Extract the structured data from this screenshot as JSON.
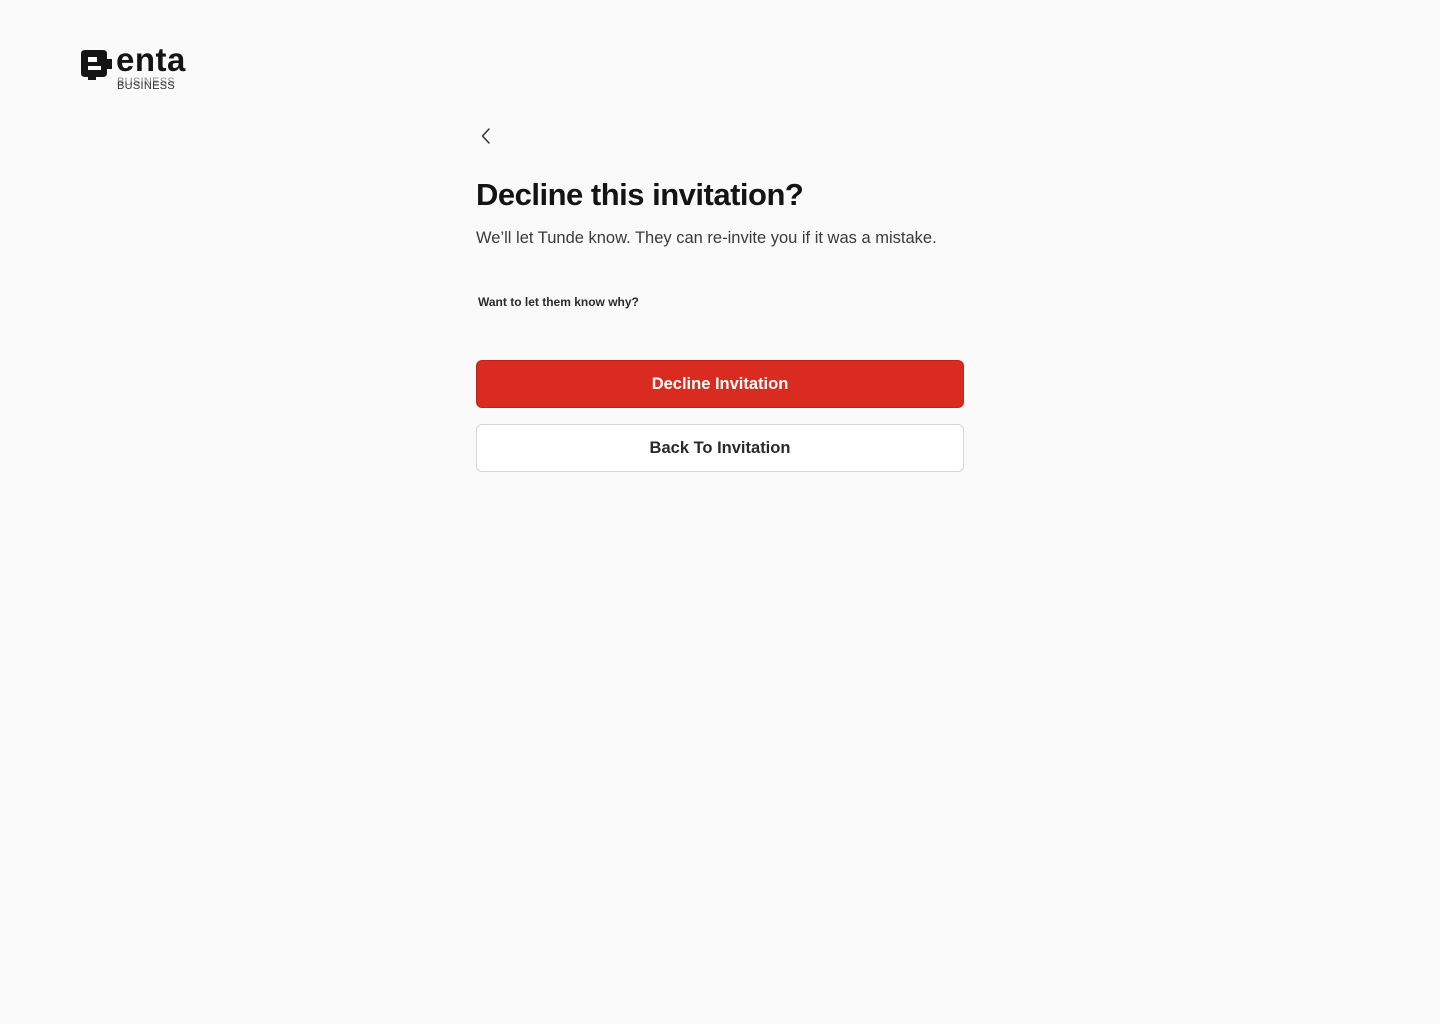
{
  "brand": {
    "name": "enta",
    "tagline": "BUSINESS"
  },
  "nav": {
    "back_icon": "chevron-left-icon"
  },
  "dialog": {
    "title": "Decline this invitation?",
    "subtitle": "We’ll let Tunde know. They can re-invite you if it was a mistake.",
    "reason_label": "Want to let them know why?"
  },
  "actions": {
    "decline_label": "Decline Invitation",
    "back_label": "Back To Invitation"
  },
  "colors": {
    "danger": "#d92b20",
    "background": "#fafafa",
    "text": "#141414"
  }
}
